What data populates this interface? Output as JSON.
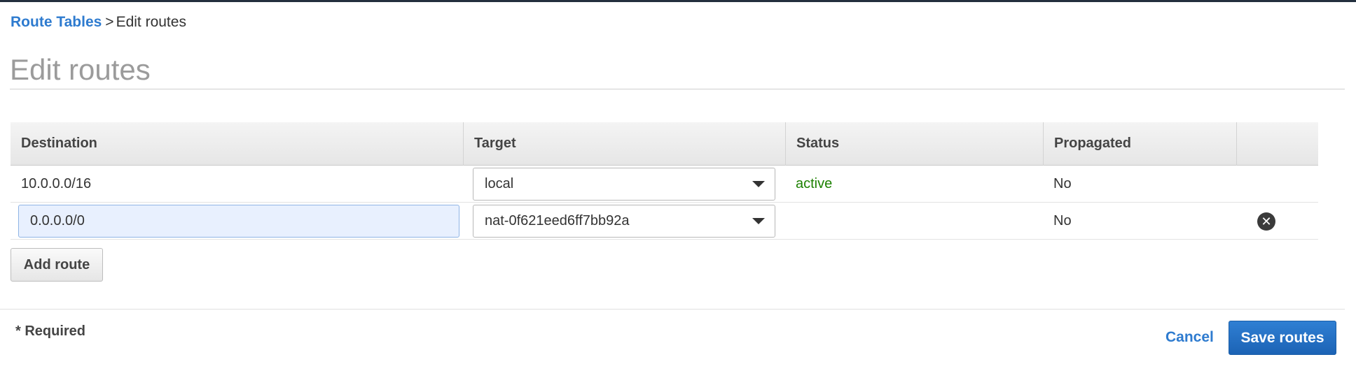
{
  "breadcrumb": {
    "parent_label": "Route Tables",
    "separator": ">",
    "current_label": "Edit routes"
  },
  "page_title": "Edit routes",
  "table": {
    "columns": [
      "Destination",
      "Target",
      "Status",
      "Propagated",
      ""
    ],
    "rows": [
      {
        "destination": "10.0.0.0/16",
        "destination_editable": false,
        "target": "local",
        "status": "active",
        "propagated": "No",
        "removable": false
      },
      {
        "destination": "0.0.0.0/0",
        "destination_editable": true,
        "target": "nat-0f621eed6ff7bb92a",
        "status": "",
        "propagated": "No",
        "removable": true
      }
    ]
  },
  "add_route_label": "Add route",
  "required_note": "* Required",
  "footer": {
    "cancel_label": "Cancel",
    "save_label": "Save routes"
  },
  "colors": {
    "link": "#2e7bcf",
    "status_active": "#1d8102",
    "primary_button": "#1c63b5",
    "topbar": "#232f3e"
  },
  "icons": {
    "remove": "close-circle-icon",
    "dropdown": "caret-down-icon"
  }
}
